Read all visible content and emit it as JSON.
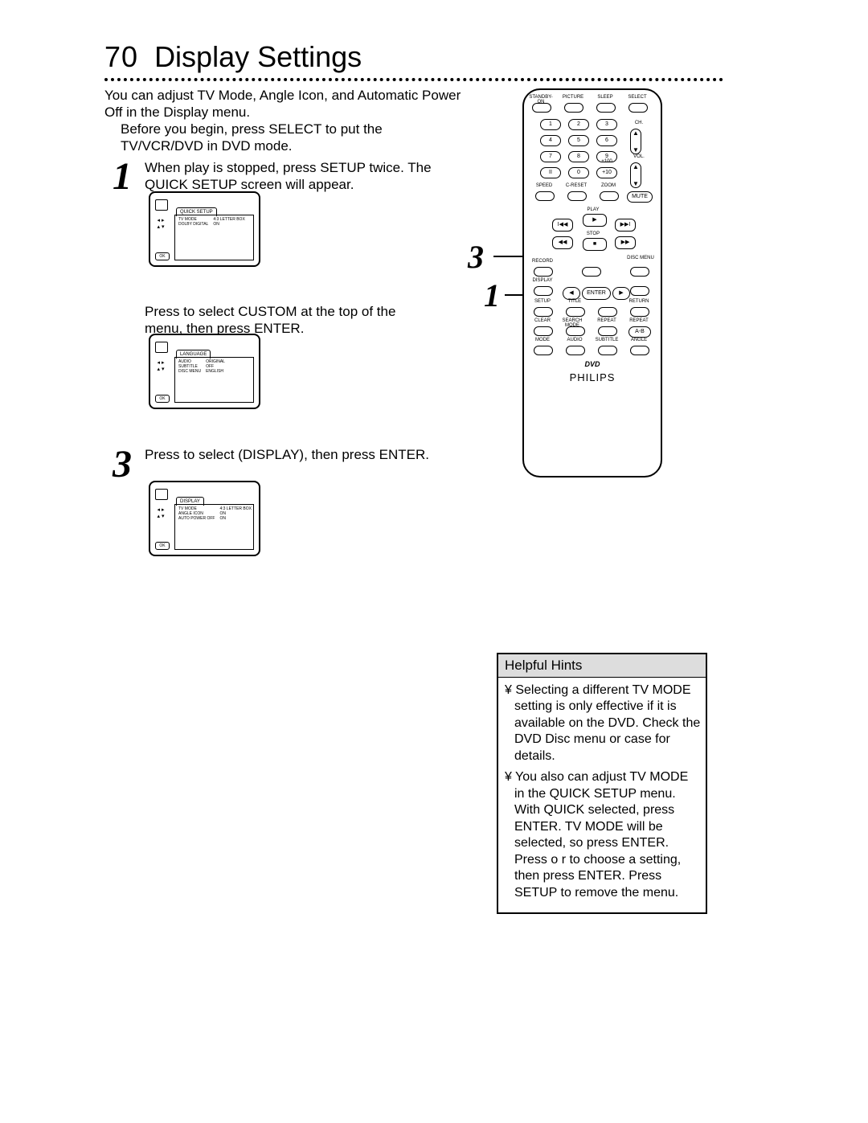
{
  "page_number": "70",
  "title": "Display Settings",
  "intro": "You can adjust TV Mode, Angle Icon, and Automatic Power Off in the Display menu.",
  "before": "Before you begin, press SELECT to put the TV/VCR/DVD in DVD mode.",
  "steps": {
    "s1": "When play is stopped, press SETUP twice. The QUICK SETUP screen will appear.",
    "s2": "Press      to select CUSTOM at the top of the menu, then press ENTER.",
    "s3": "Press      to select          (DISPLAY), then press ENTER."
  },
  "osd": {
    "a": {
      "tab": "QUICK SETUP",
      "rows": [
        [
          "TV MODE",
          "4:3 LETTER BOX"
        ],
        [
          "DOLBY DIGITAL",
          "ON"
        ]
      ]
    },
    "b": {
      "tab": "LANGUAGE",
      "rows": [
        [
          "AUDIO",
          "ORIGINAL"
        ],
        [
          "SUBTITLE",
          "OFF"
        ],
        [
          "DISC MENU",
          "ENGLISH"
        ]
      ]
    },
    "c": {
      "tab": "DISPLAY",
      "rows": [
        [
          "TV MODE",
          "4:3 LETTER BOX"
        ],
        [
          "ANGLE ICON",
          "ON"
        ],
        [
          "AUTO POWER OFF",
          "ON"
        ]
      ]
    }
  },
  "remote": {
    "top_labels": [
      "STANDBY-ON",
      "PICTURE",
      "SLEEP",
      "SELECT"
    ],
    "numbers": [
      "1",
      "2",
      "3",
      "4",
      "5",
      "6",
      "7",
      "8",
      "9",
      "II",
      "0",
      "+10"
    ],
    "ch_label": "CH.",
    "vol_label": "VOL.",
    "plus100": "+100",
    "row_speed": [
      "SPEED",
      "C-RESET",
      "ZOOM"
    ],
    "mute": "MUTE",
    "play_labels": {
      "rewind": "◀◀",
      "play": "PLAY",
      "ff": "▶▶",
      "prev": "I◀◀",
      "next": "▶▶I",
      "stop": "STOP"
    },
    "mid_left": "RECORD",
    "mid_right": "DISC MENU",
    "display": "DISPLAY",
    "enter_row": [
      "◀",
      "ENTER",
      "▶"
    ],
    "row_setup": [
      "SETUP",
      "TITLE",
      "",
      "RETURN"
    ],
    "row_clear": [
      "CLEAR",
      "SEARCH MODE",
      "REPEAT",
      "REPEAT"
    ],
    "ab": "A-B",
    "row_mode": [
      "MODE",
      "AUDIO",
      "SUBTITLE",
      "ANGLE"
    ],
    "dvd": "DVD",
    "brand": "PHILIPS"
  },
  "callouts": {
    "c3": "3",
    "c1": "1"
  },
  "hints": {
    "title": "Helpful Hints",
    "items": [
      "¥  Selecting a different TV MODE setting is only effective if it is available on the DVD. Check the DVD Disc menu or case for details.",
      "¥  You also can adjust TV MODE in the QUICK SETUP menu. With QUICK selected, press ENTER. TV MODE will be selected, so press ENTER. Press o r       to choose a setting, then press ENTER. Press SETUP to remove the menu."
    ]
  }
}
